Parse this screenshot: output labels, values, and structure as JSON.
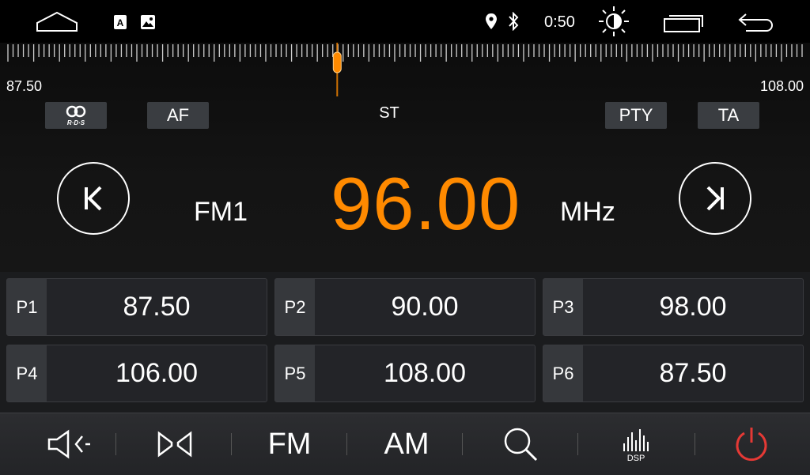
{
  "status_bar": {
    "time": "0:50",
    "icons": [
      "home-icon",
      "app-notification-icon",
      "image-notification-icon",
      "location-icon",
      "bluetooth-icon",
      "brightness-icon",
      "recent-apps-icon",
      "back-icon"
    ]
  },
  "tuner": {
    "range_min": "87.50",
    "range_max": "108.00",
    "flags": {
      "rds": "R·D·S",
      "af": "AF",
      "st": "ST",
      "pty": "PTY",
      "ta": "TA"
    },
    "band": "FM1",
    "frequency": "96.00",
    "unit": "MHz",
    "accent_color": "#ff8a00"
  },
  "presets": [
    {
      "label": "P1",
      "freq": "87.50"
    },
    {
      "label": "P2",
      "freq": "90.00"
    },
    {
      "label": "P3",
      "freq": "98.00"
    },
    {
      "label": "P4",
      "freq": "106.00"
    },
    {
      "label": "P5",
      "freq": "108.00"
    },
    {
      "label": "P6",
      "freq": "87.50"
    }
  ],
  "bottom_bar": {
    "fm_label": "FM",
    "am_label": "AM",
    "dsp_label": "DSP",
    "power_color": "#e53935",
    "icons": [
      "volume-icon",
      "stereo-mono-icon",
      "search-icon",
      "dsp-equalizer-icon",
      "power-icon"
    ]
  }
}
